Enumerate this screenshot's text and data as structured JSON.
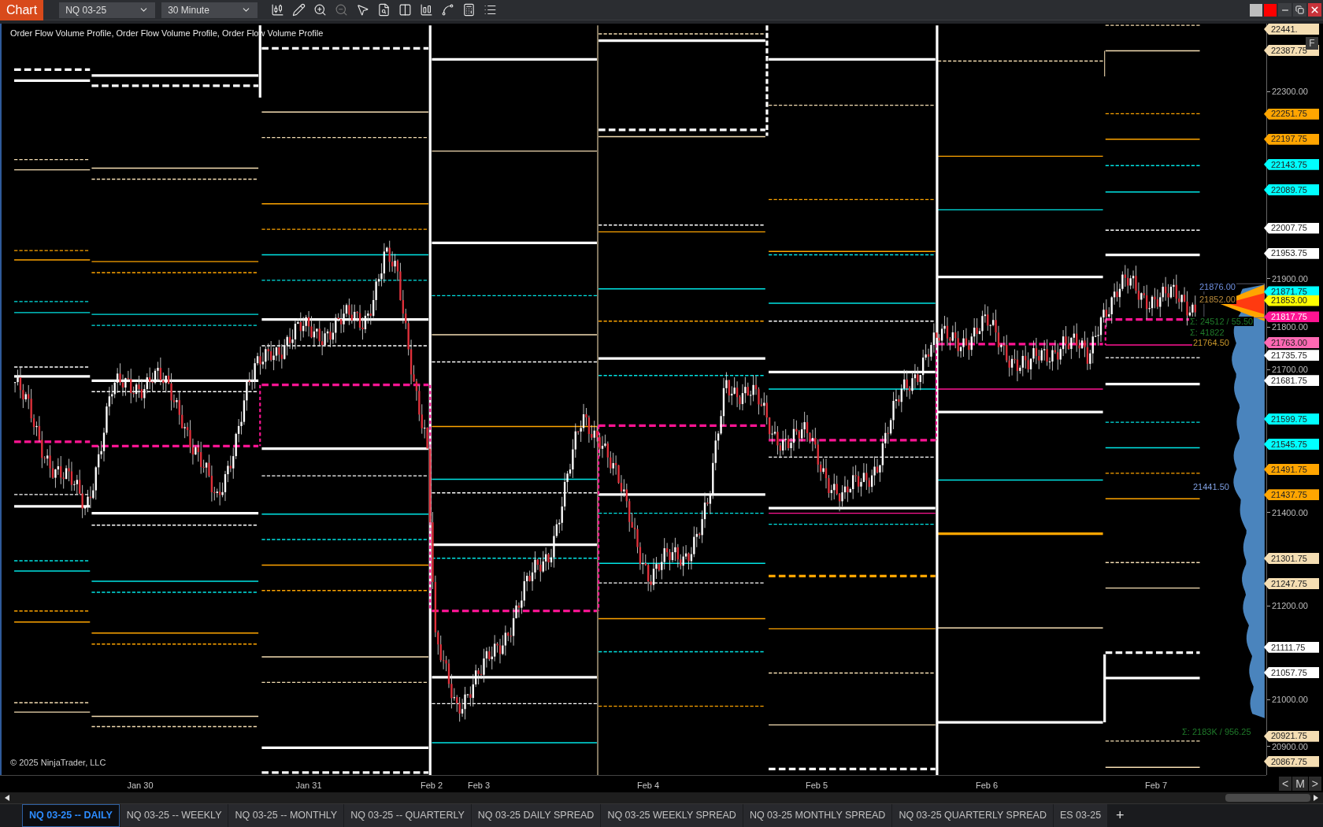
{
  "toolbar": {
    "title": "Chart",
    "instrument": "NQ 03-25",
    "interval": "30 Minute"
  },
  "chart": {
    "indicator_label": "Order Flow Volume Profile, Order Flow Volume Profile, Order Flow Volume Profile",
    "copyright": "© 2025 NinjaTrader, LLC",
    "profile_labels": [
      {
        "text": "21876.00",
        "color": "#6f8fdf"
      },
      {
        "text": "21852.00",
        "color": "#b88a3a"
      },
      {
        "text": "Σ: 24512 / 55.50",
        "color": "#1f7a2a"
      },
      {
        "text": "Σ: 41822",
        "color": "#1f7a2a"
      },
      {
        "text": "21764.50",
        "color": "#c8962a"
      },
      {
        "text": "21441.50",
        "color": "#7f9fe0"
      },
      {
        "text": "Σ: 2183K / 956.25",
        "color": "#1f7a2a"
      }
    ],
    "price_ticks": [
      "22300.00",
      "21900.00",
      "21800.00",
      "21700.00",
      "21400.00",
      "21200.00",
      "21000.00",
      "20900.00"
    ],
    "price_tags": [
      {
        "text": "22441.",
        "color": "#f5deb3"
      },
      {
        "text": "22387.75",
        "color": "#f5deb3"
      },
      {
        "text": "22251.75",
        "color": "#ffa500"
      },
      {
        "text": "22197.75",
        "color": "#ffa500"
      },
      {
        "text": "22143.75",
        "color": "#00ffff"
      },
      {
        "text": "22089.75",
        "color": "#00ffff"
      },
      {
        "text": "22007.75",
        "color": "#ffffff"
      },
      {
        "text": "21953.75",
        "color": "#ffffff"
      },
      {
        "text": "21871.75",
        "color": "#00ffff"
      },
      {
        "text": "21853.00",
        "color": "#ffff00"
      },
      {
        "text": "21817.75",
        "color": "#ff1493"
      },
      {
        "text": "21763.00",
        "color": "#ff69b4"
      },
      {
        "text": "21735.75",
        "color": "#ffffff"
      },
      {
        "text": "21681.75",
        "color": "#ffffff"
      },
      {
        "text": "21599.75",
        "color": "#00ffff"
      },
      {
        "text": "21545.75",
        "color": "#00ffff"
      },
      {
        "text": "21491.75",
        "color": "#ffa500"
      },
      {
        "text": "21437.75",
        "color": "#ffa500"
      },
      {
        "text": "21301.75",
        "color": "#f5deb3"
      },
      {
        "text": "21247.75",
        "color": "#f5deb3"
      },
      {
        "text": "21111.75",
        "color": "#ffffff"
      },
      {
        "text": "21057.75",
        "color": "#ffffff"
      },
      {
        "text": "20921.75",
        "color": "#f5deb3"
      },
      {
        "text": "20867.75",
        "color": "#f5deb3"
      }
    ],
    "axis_button": "F",
    "dates": [
      "Jan 30",
      "Jan 31",
      "Feb 2",
      "Feb 3",
      "Feb 4",
      "Feb 5",
      "Feb 6",
      "Feb 7"
    ],
    "nav_buttons": [
      "<",
      "M",
      ">"
    ]
  },
  "tabs": [
    {
      "label": "NQ 03-25 -- DAILY",
      "selected": true
    },
    {
      "label": "NQ 03-25 -- WEEKLY",
      "selected": false
    },
    {
      "label": "NQ 03-25 -- MONTHLY",
      "selected": false
    },
    {
      "label": "NQ 03-25 -- QUARTERLY",
      "selected": false
    },
    {
      "label": "NQ 03-25 DAILY SPREAD",
      "selected": false
    },
    {
      "label": "NQ 03-25 WEEKLY SPREAD",
      "selected": false
    },
    {
      "label": "NQ 03-25 MONTHLY SPREAD",
      "selected": false
    },
    {
      "label": "NQ 03-25 QUARTERLY SPREAD",
      "selected": false
    },
    {
      "label": "ES 03-25",
      "selected": false
    }
  ],
  "add_tab": "+"
}
